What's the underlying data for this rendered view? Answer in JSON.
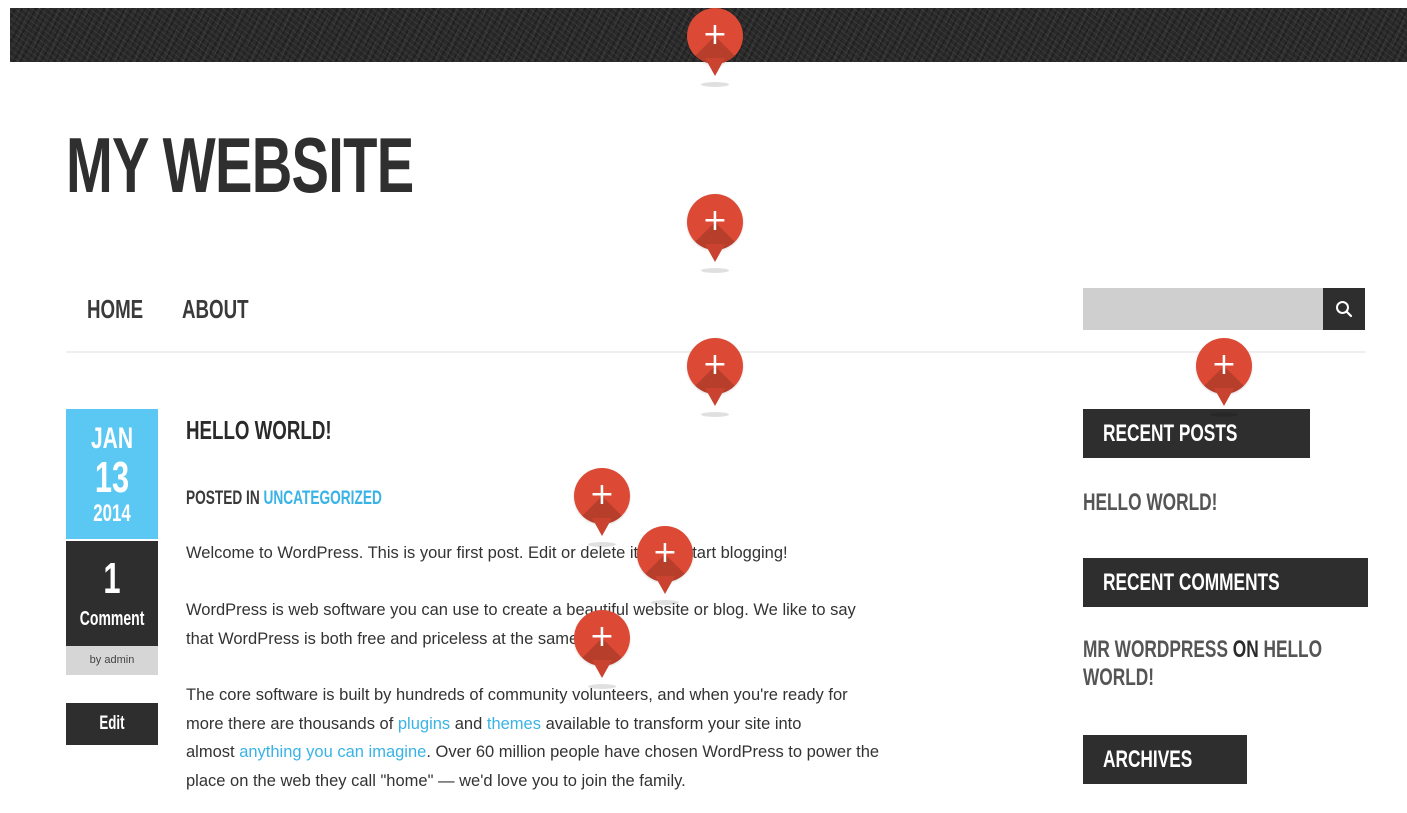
{
  "site": {
    "title": "MY WEBSITE"
  },
  "nav": {
    "items": [
      {
        "label": "HOME"
      },
      {
        "label": "ABOUT"
      }
    ]
  },
  "search": {
    "placeholder": "",
    "button_icon": "search-icon"
  },
  "post": {
    "date": {
      "month": "JAN",
      "day": "13",
      "year": "2014"
    },
    "comments": {
      "count": "1",
      "label": "Comment"
    },
    "author": "by admin",
    "edit_label": "Edit",
    "title": "HELLO WORLD!",
    "meta_prefix": "POSTED IN",
    "category": "UNCATEGORIZED",
    "paragraphs": {
      "p1": "Welcome to WordPress. This is your first post. Edit or delete it, then start blogging!",
      "p2_line1": "WordPress is web software you can use to create a beautiful website or blog. We like to say",
      "p2_line2": "that WordPress is both free and priceless at the same time.",
      "p3_line1": "The core software is built by hundreds of community volunteers, and when you're ready for",
      "p3_line2_a": "more there are thousands of ",
      "p3_line2_link1": "plugins",
      "p3_line2_b": " and ",
      "p3_line2_link2": "themes",
      "p3_line2_c": " available to transform your site into",
      "p3_line3_a": "almost ",
      "p3_line3_link": "anything you can imagine",
      "p3_line3_b": ". Over 60 million people have chosen WordPress to power the",
      "p3_line4": "place on the web they call \"home\" — we'd love you to join the family."
    }
  },
  "sidebar": {
    "recent_posts": {
      "title": "RECENT POSTS",
      "items": [
        "HELLO WORLD!"
      ]
    },
    "recent_comments": {
      "title": "RECENT COMMENTS",
      "author": "MR WORDPRESS",
      "on": " ON ",
      "post_line1": "HELLO",
      "post_line2": "WORLD!"
    },
    "archives": {
      "title": "ARCHIVES"
    }
  },
  "pins": {
    "icon": "plus-icon",
    "glyph": "+"
  },
  "colors": {
    "accent": "#5bc8f3",
    "link": "#39b3e6",
    "dark": "#2e2e2e",
    "pin": "#dc4a35"
  }
}
